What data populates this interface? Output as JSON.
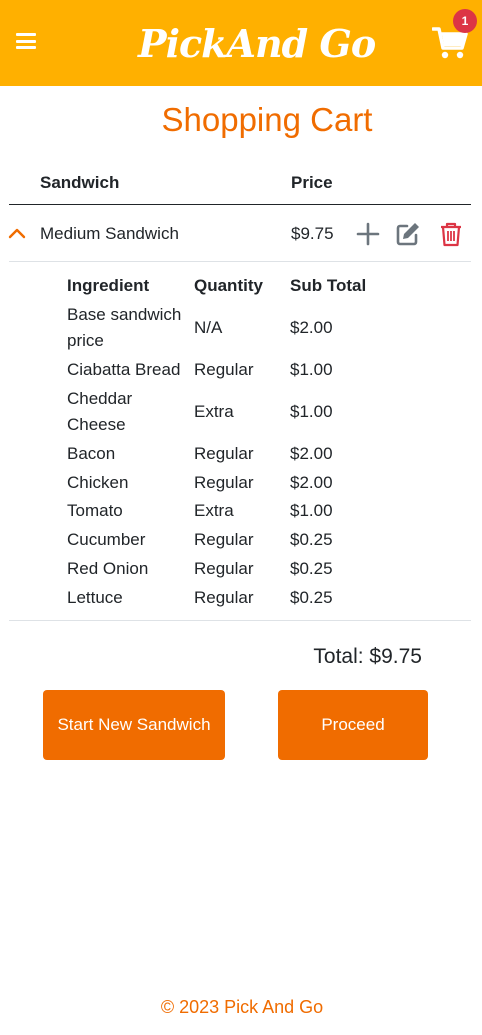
{
  "header": {
    "brand": "PickAnd Go",
    "cart_count": "1"
  },
  "page": {
    "title": "Shopping Cart"
  },
  "cart_table": {
    "headers": {
      "sandwich": "Sandwich",
      "price": "Price"
    },
    "items": [
      {
        "name": "Medium Sandwich",
        "price": "$9.75"
      }
    ]
  },
  "ingredients": {
    "headers": {
      "ingredient": "Ingredient",
      "quantity": "Quantity",
      "subtotal": "Sub Total"
    },
    "rows": [
      {
        "ingredient": "Base sandwich price",
        "quantity": "N/A",
        "subtotal": "$2.00"
      },
      {
        "ingredient": "Ciabatta Bread",
        "quantity": "Regular",
        "subtotal": "$1.00"
      },
      {
        "ingredient": "Cheddar Cheese",
        "quantity": "Extra",
        "subtotal": "$1.00"
      },
      {
        "ingredient": "Bacon",
        "quantity": "Regular",
        "subtotal": "$2.00"
      },
      {
        "ingredient": "Chicken",
        "quantity": "Regular",
        "subtotal": "$2.00"
      },
      {
        "ingredient": "Tomato",
        "quantity": "Extra",
        "subtotal": "$1.00"
      },
      {
        "ingredient": "Cucumber",
        "quantity": "Regular",
        "subtotal": "$0.25"
      },
      {
        "ingredient": "Red Onion",
        "quantity": "Regular",
        "subtotal": "$0.25"
      },
      {
        "ingredient": "Lettuce",
        "quantity": "Regular",
        "subtotal": "$0.25"
      }
    ]
  },
  "summary": {
    "total": "Total: $9.75"
  },
  "actions": {
    "start_new": "Start New Sandwich",
    "proceed": "Proceed"
  },
  "footer": {
    "copyright": "© 2023 Pick And Go"
  },
  "icons": {
    "menu": "hamburger-menu-icon",
    "cart": "shopping-cart-icon",
    "collapse": "chevron-up-icon",
    "add": "plus-icon",
    "edit": "edit-icon",
    "delete": "trash-icon"
  },
  "colors": {
    "header_bg": "#ffb000",
    "accent": "#f06c00",
    "badge": "#dc3545",
    "icon_gray": "#6c757d",
    "delete_red": "#dc3545"
  }
}
